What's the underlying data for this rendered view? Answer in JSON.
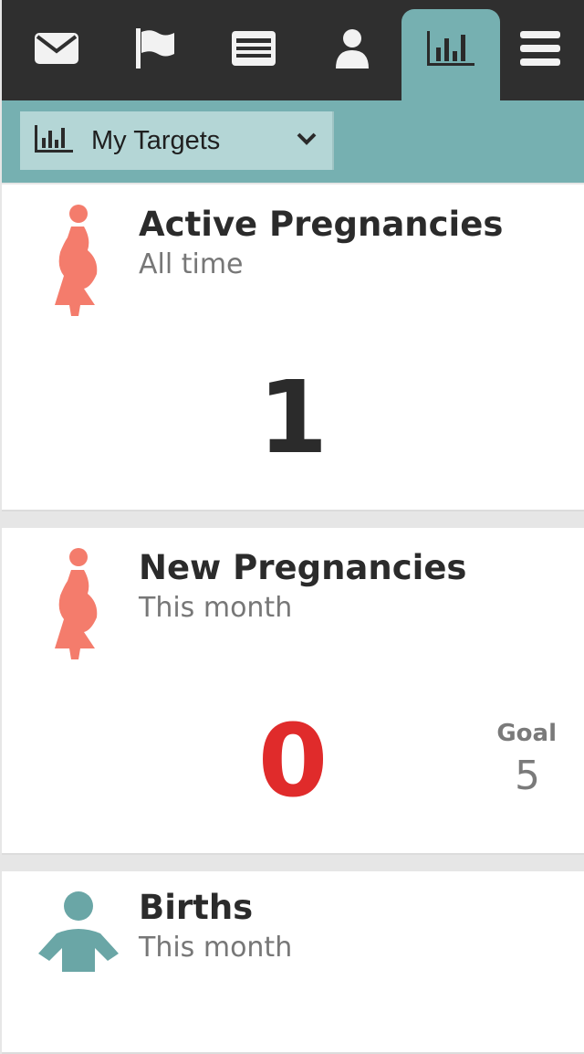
{
  "nav": {
    "tabs": [
      {
        "icon": "envelope-icon",
        "name": "tab-messages",
        "active": false
      },
      {
        "icon": "flag-icon",
        "name": "tab-tasks",
        "active": false
      },
      {
        "icon": "report-list-icon",
        "name": "tab-reports",
        "active": false
      },
      {
        "icon": "person-icon",
        "name": "tab-contacts",
        "active": false
      },
      {
        "icon": "bar-chart-icon",
        "name": "tab-analytics",
        "active": true
      },
      {
        "icon": "hamburger-menu-icon",
        "name": "tab-menu",
        "active": false
      }
    ]
  },
  "filter": {
    "selected": "My Targets",
    "icon": "bar-chart-icon"
  },
  "cards": [
    {
      "title": "Active Pregnancies",
      "period": "All time",
      "value": "1",
      "value_color": "#2b2b2b",
      "icon": "pregnant-woman-icon",
      "icon_color": "#f47c6c"
    },
    {
      "title": "New Pregnancies",
      "period": "This month",
      "value": "0",
      "value_color": "#e02b2b",
      "goal_label": "Goal",
      "goal_value": "5",
      "icon": "pregnant-woman-icon",
      "icon_color": "#f47c6c"
    },
    {
      "title": "Births",
      "period": "This month",
      "icon": "baby-icon",
      "icon_color": "#6aa6a6"
    }
  ],
  "colors": {
    "topbar": "#2f2f2f",
    "accent": "#76b0b1",
    "dropdown": "#b4d6d6"
  }
}
